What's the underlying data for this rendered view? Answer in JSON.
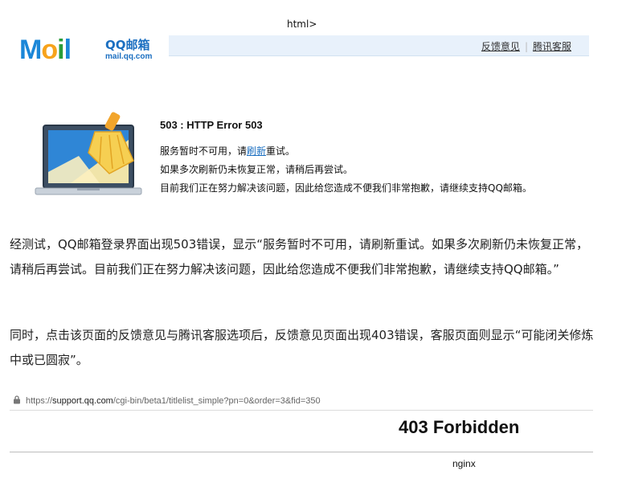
{
  "top_text": "html>",
  "logo": {
    "mail_m": "M",
    "mail_o": "o",
    "mail_i": "i",
    "mail_l": "l",
    "brand": "QQ邮箱",
    "domain": "mail.qq.com"
  },
  "header": {
    "feedback_link": "反馈意见",
    "service_link": "腾讯客服"
  },
  "error_page": {
    "title": "503 : HTTP Error 503",
    "line1_prefix": "服务暂时不可用，请",
    "line1_link": "刷新",
    "line1_suffix": "重试。",
    "line2": "如果多次刷新仍未恢复正常，请稍后再尝试。",
    "line3": "目前我们正在努力解决该问题，因此给您造成不便我们非常抱歉，请继续支持QQ邮箱。"
  },
  "article": {
    "paragraph1": "经测试，QQ邮箱登录界面出现503错误，显示“服务暂时不可用，请刷新重试。如果多次刷新仍未恢复正常，请稍后再尝试。目前我们正在努力解决该问题，因此给您造成不便我们非常抱歉，请继续支持QQ邮箱。”",
    "paragraph2": "同时，点击该页面的反馈意见与腾讯客服选项后，反馈意见页面出现403错误，客服页面则显示“可能闭关修炼中或已圆寂”。"
  },
  "second_screenshot": {
    "url_prefix": "https://",
    "url_host": "support.qq.com",
    "url_path": "/cgi-bin/beta1/titlelist_simple?pn=0&order=3&fid=350",
    "heading": "403 Forbidden",
    "server": "nginx"
  },
  "colors": {
    "qq_blue": "#1b87d8",
    "header_bar": "#e8f1fb",
    "link_blue": "#1b6fc1"
  }
}
